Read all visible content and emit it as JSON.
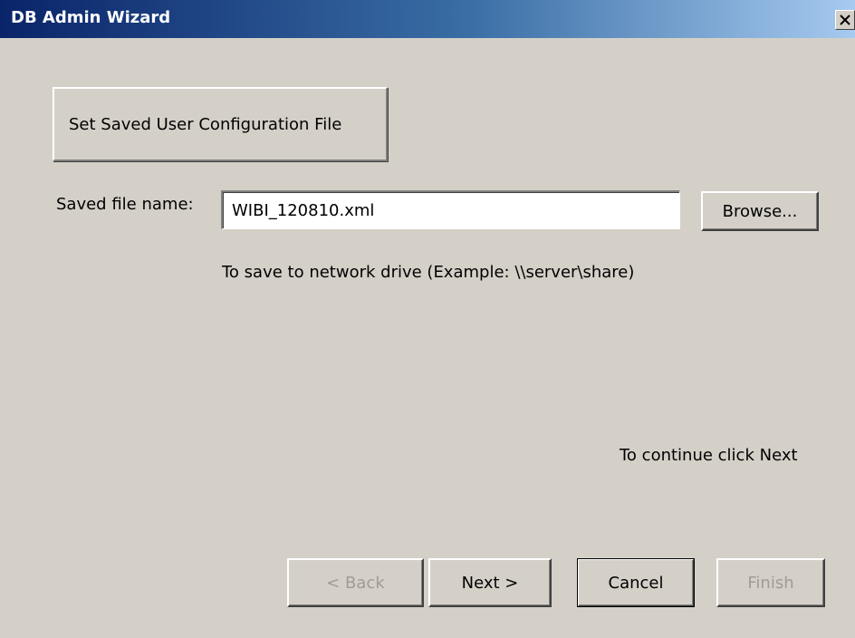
{
  "window": {
    "title": "DB Admin Wizard"
  },
  "step": {
    "label": "Set Saved User Configuration File"
  },
  "form": {
    "saved_file_label": "Saved file name:",
    "saved_file_value": "WIBI_120810.xml",
    "browse_label": "Browse...",
    "network_hint": "To save to network drive (Example: \\\\server\\share)",
    "continue_hint": "To continue click Next"
  },
  "footer": {
    "back_label": "< Back",
    "next_label": "Next >",
    "cancel_label": "Cancel",
    "finish_label": "Finish"
  },
  "icons": {
    "close": "close-icon"
  }
}
